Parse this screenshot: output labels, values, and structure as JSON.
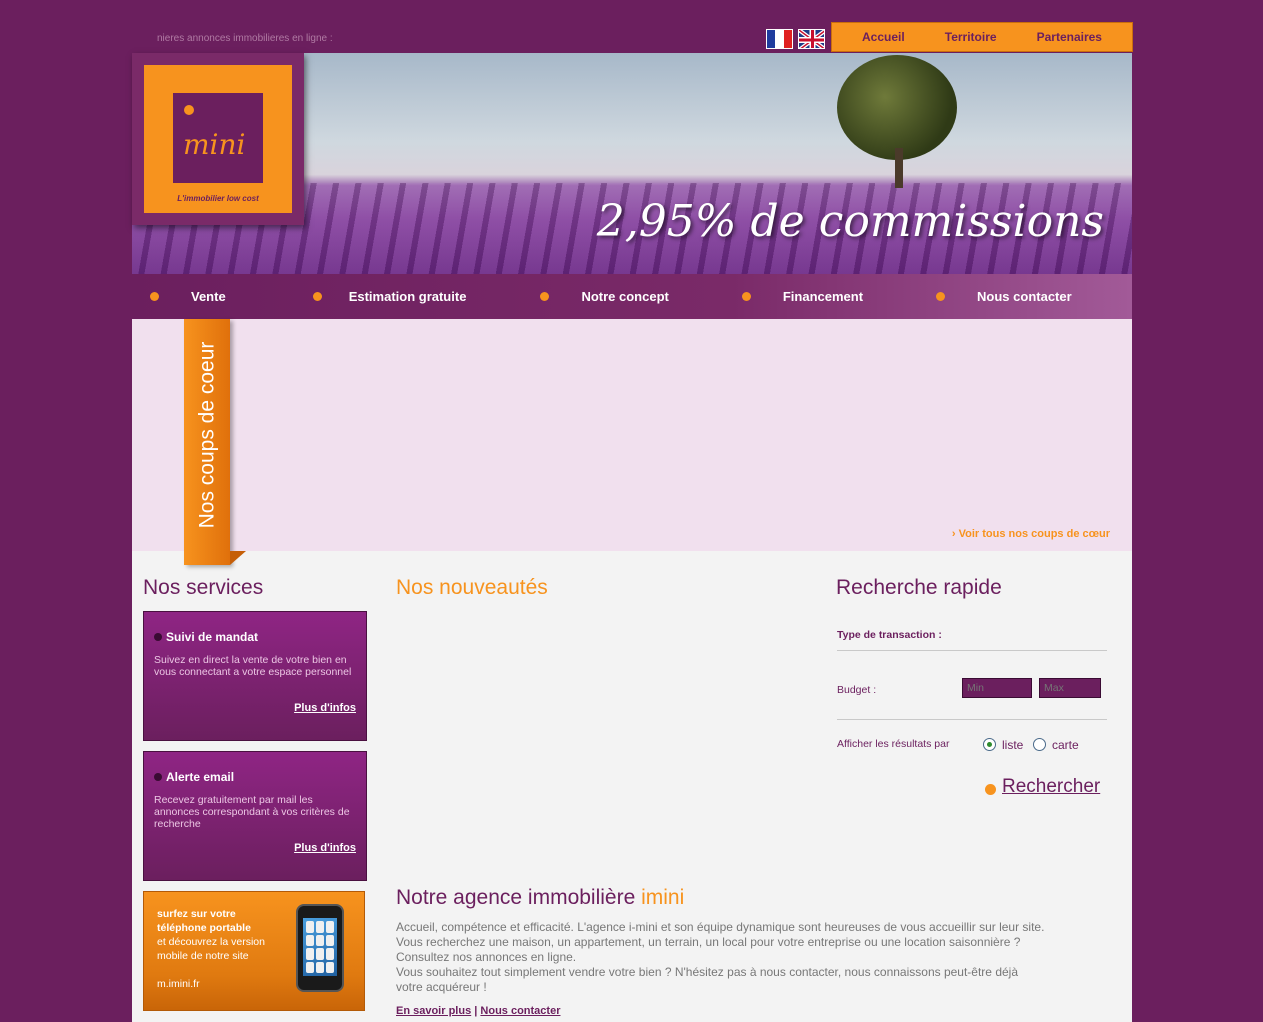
{
  "ticker": "nieres annonces immobilieres en ligne :",
  "flags": {
    "fr": "flag-france-icon",
    "en": "flag-uk-icon"
  },
  "top_nav": [
    "Accueil",
    "Territoire",
    "Partenaires"
  ],
  "logo": {
    "word": "mini",
    "tagline": "L'immobilier low cost"
  },
  "banner": {
    "slogan": "2,95% de commissions"
  },
  "main_nav": [
    "Vente",
    "Estimation gratuite",
    "Notre concept",
    "Financement",
    "Nous contacter"
  ],
  "coups": {
    "ribbon": "Nos coups de coeur",
    "link": "› Voir tous nos coups de cœur"
  },
  "services": {
    "title": "Nos services",
    "items": [
      {
        "title": "Suivi de mandat",
        "desc": "Suivez en direct la vente de votre bien en vous connectant a votre espace personnel",
        "more": "Plus d'infos"
      },
      {
        "title": "Alerte email",
        "desc": "Recevez gratuitement par mail les annonces correspondant à vos critères de recherche",
        "more": "Plus d'infos"
      }
    ],
    "mobile": {
      "line1": "surfez sur votre",
      "line2": "téléphone portable",
      "line3": "et découvrez la version",
      "line4": "mobile de notre site",
      "url": "m.imini.fr"
    }
  },
  "news": {
    "title": "Nos nouveautés"
  },
  "search": {
    "title": "Recherche rapide",
    "transaction_label": "Type de transaction :",
    "budget_label": "Budget :",
    "min_placeholder": "Min",
    "max_placeholder": "Max",
    "display_label": "Afficher les résultats par",
    "option_list": "liste",
    "option_map": "carte",
    "button": "Rechercher"
  },
  "agency": {
    "title_main": "Notre agence immobilière ",
    "title_brand": "imini",
    "lines": [
      "Accueil, compétence et efficacité. L'agence i-mini et son équipe dynamique sont heureuses de vous accueillir sur leur site.",
      "Vous recherchez une maison, un appartement, un terrain, un local pour votre entreprise ou une location saisonnière ?",
      "Consultez nos annonces en ligne.",
      "Vous souhaitez tout simplement vendre votre bien ? N'hésitez pas à nous contacter, nous connaissons peut-être déjà",
      "votre acquéreur !"
    ],
    "link_more": "En savoir plus",
    "separator": " | ",
    "link_contact": "Nous contacter"
  },
  "colors": {
    "purple": "#6b1f5e",
    "orange": "#f7931e",
    "pink_bg": "#f1e0ee"
  }
}
